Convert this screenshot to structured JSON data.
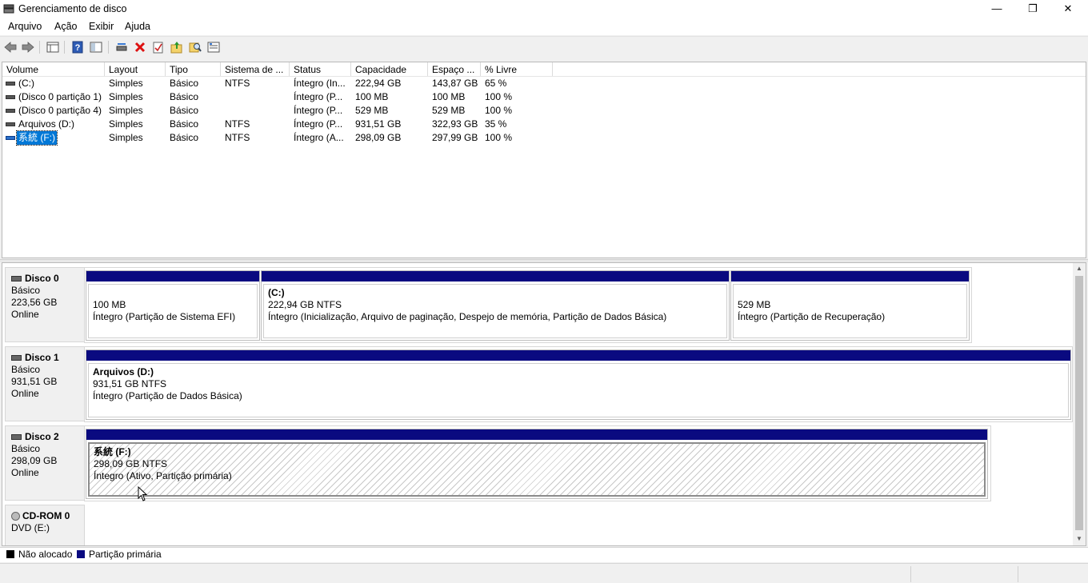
{
  "window": {
    "title": "Gerenciamento de disco",
    "minimize_glyph": "—",
    "maximize_glyph": "❐",
    "close_glyph": "✕"
  },
  "menu": [
    "Arquivo",
    "Ação",
    "Exibir",
    "Ajuda"
  ],
  "toolbar_icons": [
    "back-arrow-icon",
    "forward-arrow-icon",
    "properties-grid-icon",
    "help-icon",
    "console-tree-icon",
    "connect-drive-icon",
    "delete-icon",
    "check-icon",
    "folder-up-icon",
    "find-icon",
    "list-icon"
  ],
  "volume_list": {
    "columns": [
      "Volume",
      "Layout",
      "Tipo",
      "Sistema de ...",
      "Status",
      "Capacidade",
      "Espaço ...",
      "% Livre"
    ],
    "rows": [
      {
        "volume": " (C:)",
        "layout": "Simples",
        "tipo": "Básico",
        "sistema": "NTFS",
        "status": "Íntegro (In...",
        "capacidade": "222,94 GB",
        "espaco": "143,87 GB",
        "livre": "65 %"
      },
      {
        "volume": "(Disco 0 partição 1)",
        "layout": "Simples",
        "tipo": "Básico",
        "sistema": "",
        "status": "Íntegro (P...",
        "capacidade": "100 MB",
        "espaco": "100 MB",
        "livre": "100 %"
      },
      {
        "volume": "(Disco 0 partição 4)",
        "layout": "Simples",
        "tipo": "Básico",
        "sistema": "",
        "status": "Íntegro (P...",
        "capacidade": "529 MB",
        "espaco": "529 MB",
        "livre": "100 %"
      },
      {
        "volume": "Arquivos (D:)",
        "layout": "Simples",
        "tipo": "Básico",
        "sistema": "NTFS",
        "status": "Íntegro (P...",
        "capacidade": "931,51 GB",
        "espaco": "322,93 GB",
        "livre": "35 %"
      },
      {
        "volume": "系統 (F:)",
        "layout": "Simples",
        "tipo": "Básico",
        "sistema": "NTFS",
        "status": "Íntegro (A...",
        "capacidade": "298,09 GB",
        "espaco": "297,99 GB",
        "livre": "100 %"
      }
    ]
  },
  "disks": [
    {
      "name": "Disco 0",
      "type": "Básico",
      "size": "223,56 GB",
      "state": "Online",
      "partitions": [
        {
          "name": "",
          "size": "100 MB",
          "status": "Íntegro (Partição de Sistema EFI)"
        },
        {
          "name": " (C:)",
          "size": "222,94 GB NTFS",
          "status": "Íntegro (Inicialização, Arquivo de paginação, Despejo de memória, Partição de Dados Básica)"
        },
        {
          "name": "",
          "size": "529 MB",
          "status": "Íntegro (Partição de Recuperação)"
        }
      ]
    },
    {
      "name": "Disco 1",
      "type": "Básico",
      "size": "931,51 GB",
      "state": "Online",
      "partitions": [
        {
          "name": "Arquivos  (D:)",
          "size": "931,51 GB NTFS",
          "status": "Íntegro (Partição de Dados Básica)"
        }
      ]
    },
    {
      "name": "Disco 2",
      "type": "Básico",
      "size": "298,09 GB",
      "state": "Online",
      "partitions": [
        {
          "name": "系統  (F:)",
          "size": "298,09 GB NTFS",
          "status": "Íntegro (Ativo, Partição primária)"
        }
      ]
    },
    {
      "name": "CD-ROM 0",
      "type": "DVD (E:)",
      "size": "",
      "state": "",
      "partitions": []
    }
  ],
  "legend": [
    {
      "label": "Não alocado",
      "color": "#000000"
    },
    {
      "label": "Partição primária",
      "color": "#0a0a80"
    }
  ],
  "colors": {
    "partition_bar": "#0a0a80",
    "selection": "#0078d7"
  }
}
